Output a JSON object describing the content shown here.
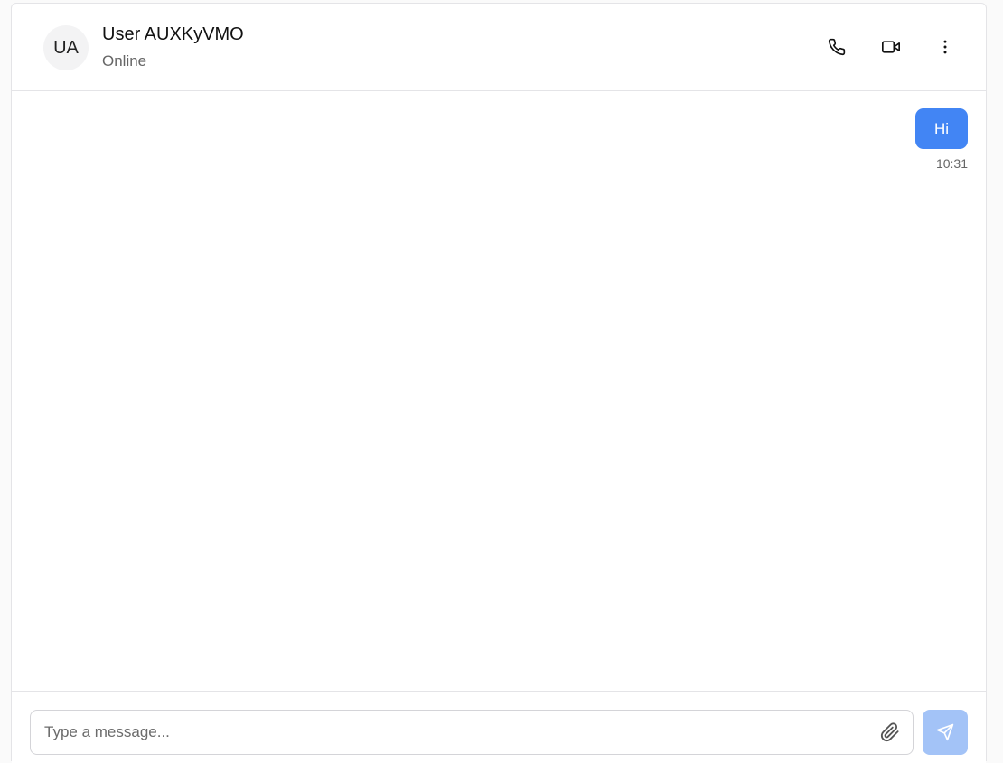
{
  "header": {
    "avatar_initials": "UA",
    "user_name": "User AUXKyVMO",
    "status": "Online",
    "actions": [
      {
        "name": "phone-button",
        "icon": "phone-icon"
      },
      {
        "name": "video-call-button",
        "icon": "video-icon"
      },
      {
        "name": "more-options-button",
        "icon": "more-vertical-icon"
      }
    ]
  },
  "messages": [
    {
      "sender": "me",
      "text": "Hi",
      "time": "10:31"
    }
  ],
  "composer": {
    "placeholder": "Type a message...",
    "value": "",
    "attach_icon": "paperclip-icon",
    "send_icon": "send-icon"
  },
  "colors": {
    "accent": "#4285f4",
    "send_disabled": "#a3c3f7",
    "border": "#e4e4e7",
    "muted_text": "#666666"
  }
}
